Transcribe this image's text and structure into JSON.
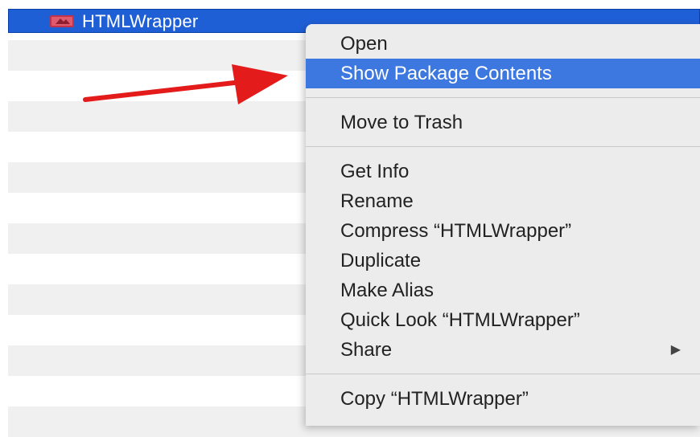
{
  "file_list": {
    "selected_item": {
      "name": "HTMLWrapper",
      "icon": "app-file-icon"
    }
  },
  "context_menu": {
    "groups": [
      [
        {
          "label": "Open",
          "highlighted": false
        },
        {
          "label": "Show Package Contents",
          "highlighted": true
        }
      ],
      [
        {
          "label": "Move to Trash",
          "highlighted": false
        }
      ],
      [
        {
          "label": "Get Info",
          "highlighted": false
        },
        {
          "label": "Rename",
          "highlighted": false
        },
        {
          "label": "Compress “HTMLWrapper”",
          "highlighted": false
        },
        {
          "label": "Duplicate",
          "highlighted": false
        },
        {
          "label": "Make Alias",
          "highlighted": false
        },
        {
          "label": "Quick Look “HTMLWrapper”",
          "highlighted": false
        },
        {
          "label": "Share",
          "highlighted": false,
          "submenu": true
        }
      ],
      [
        {
          "label": "Copy “HTMLWrapper”",
          "highlighted": false
        }
      ]
    ],
    "submenu_arrow": "▶"
  },
  "annotation": {
    "arrow_color": "#e31b1b"
  },
  "colors": {
    "selection": "#1f5fd6",
    "highlight": "#3d78e0",
    "menu_bg": "#ececec"
  }
}
